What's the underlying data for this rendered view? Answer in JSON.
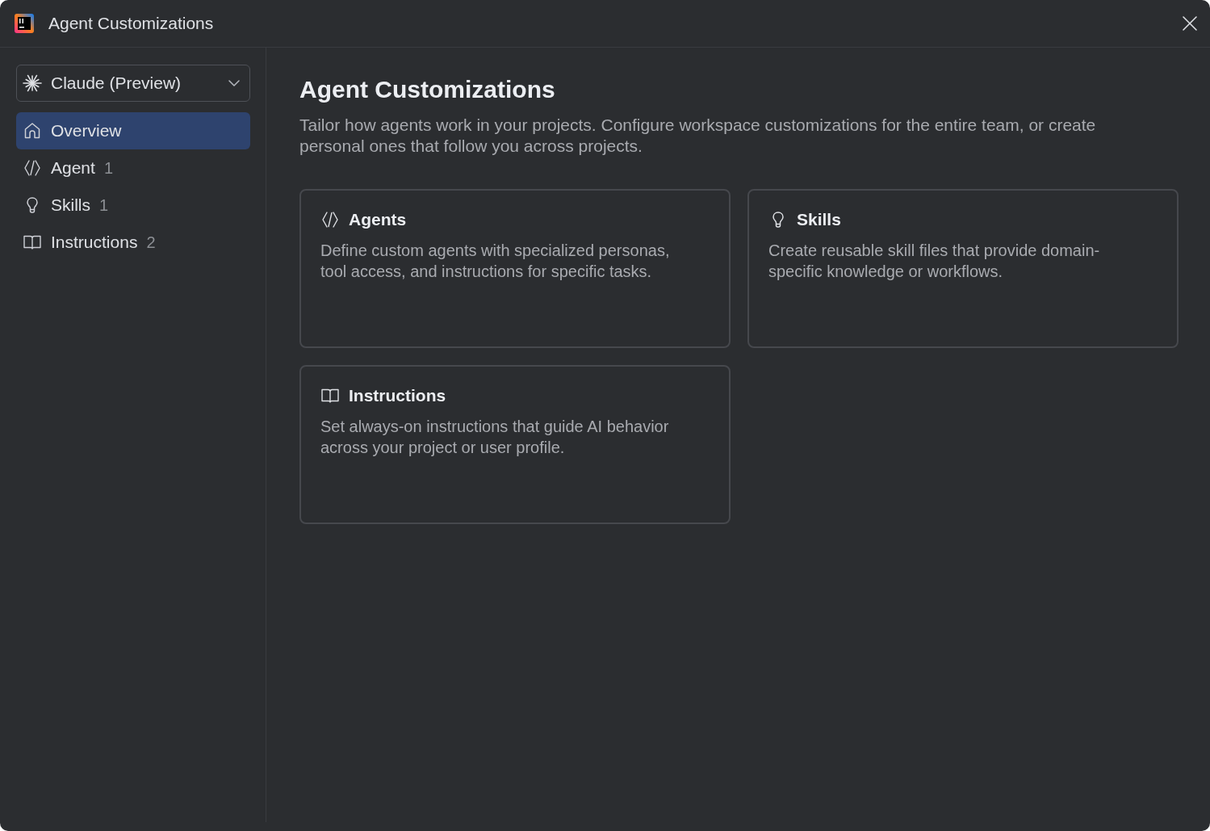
{
  "window": {
    "title": "Agent Customizations"
  },
  "sidebar": {
    "provider_dropdown": {
      "value": "Claude (Preview)"
    },
    "items": [
      {
        "kind": "overview",
        "label": "Overview",
        "selected": true
      },
      {
        "kind": "agents",
        "label": "Agent",
        "count": "1",
        "selected": false
      },
      {
        "kind": "skills",
        "label": "Skills",
        "count": "1",
        "selected": false
      },
      {
        "kind": "instructions",
        "label": "Instructions",
        "count": "2",
        "selected": false
      }
    ]
  },
  "main": {
    "heading": "Agent Customizations",
    "description": "Tailor how agents work in your projects. Configure workspace customizations for the entire team, or create personal ones that follow you across projects.",
    "cards": [
      {
        "kind": "agents",
        "title": "Agents",
        "description": "Define custom agents with specialized personas, tool access, and instructions for specific tasks."
      },
      {
        "kind": "skills",
        "title": "Skills",
        "description": "Create reusable skill files that provide domain-specific knowledge or workflows."
      },
      {
        "kind": "instructions",
        "title": "Instructions",
        "description": "Set always-on instructions that guide AI behavior across your project or user profile."
      }
    ]
  }
}
